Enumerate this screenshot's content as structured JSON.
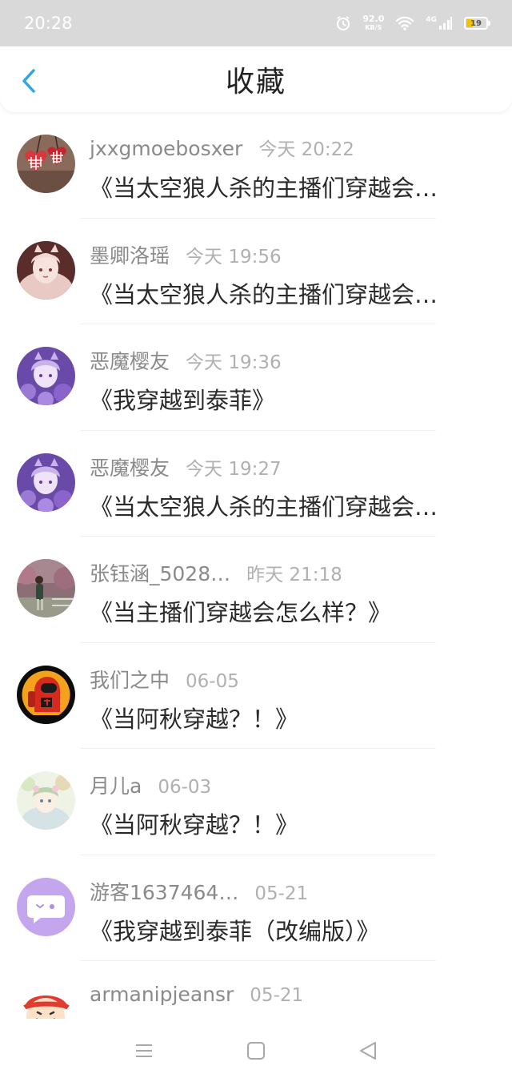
{
  "status_bar": {
    "time": "20:28",
    "speed_value": "92.0",
    "speed_unit": "KB/S",
    "network": "4G",
    "battery": "19"
  },
  "header": {
    "title": "收藏"
  },
  "items": [
    {
      "username": "jxxgmoebosxer",
      "timestamp": "今天 20:22",
      "title": "《当太空狼人杀的主播们穿越会…",
      "avatar": "hearts-avatar"
    },
    {
      "username": "墨卿洛瑶",
      "timestamp": "今天 19:56",
      "title": "《当太空狼人杀的主播们穿越会…",
      "avatar": "anime-girl-avatar"
    },
    {
      "username": "恶魔樱友",
      "timestamp": "今天 19:36",
      "title": "《我穿越到泰菲》",
      "avatar": "purple-anime-avatar"
    },
    {
      "username": "恶魔樱友",
      "timestamp": "今天 19:27",
      "title": "《当太空狼人杀的主播们穿越会…",
      "avatar": "purple-anime-avatar"
    },
    {
      "username": "张钰涵_5028…",
      "timestamp": "昨天 21:18",
      "title": "《当主播们穿越会怎么样？》",
      "avatar": "outdoor-photo-avatar"
    },
    {
      "username": "我们之中",
      "timestamp": "06-05",
      "title": "《当阿秋穿越？！》",
      "avatar": "among-us-avatar"
    },
    {
      "username": "月儿a",
      "timestamp": "06-03",
      "title": "《当阿秋穿越？！》",
      "avatar": "fairy-anime-avatar"
    },
    {
      "username": "游客1637464…",
      "timestamp": "05-21",
      "title": "《我穿越到泰菲（改编版）》",
      "avatar": "default-chat-avatar"
    },
    {
      "username": "armanipjeansr",
      "timestamp": "05-21",
      "title": "",
      "avatar": "cartoon-avatar"
    }
  ],
  "colors": {
    "accent": "#2fa6e8",
    "status_bar": "#d9d9d9",
    "username": "#8a8a8a",
    "timestamp": "#b0b0b0",
    "title": "#2a2a2a"
  }
}
